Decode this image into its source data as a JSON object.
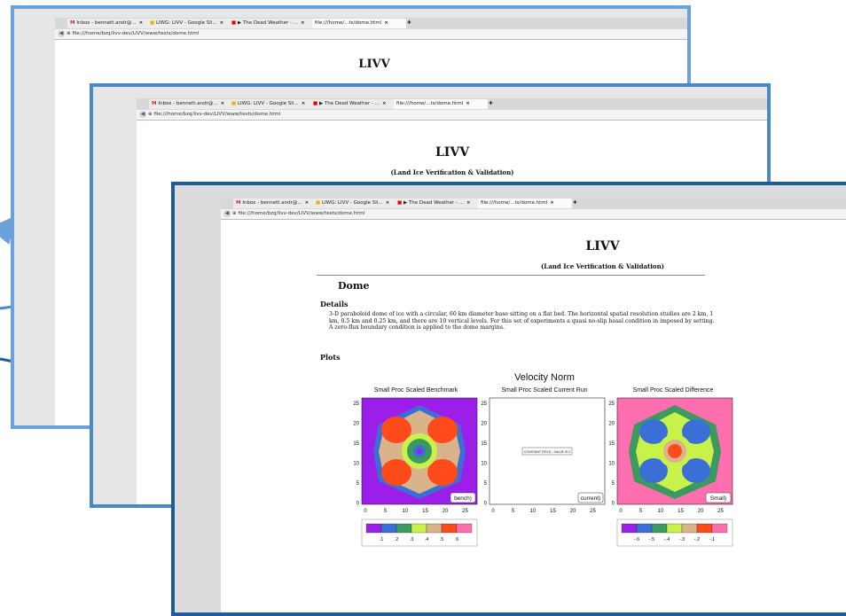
{
  "browser": {
    "tabs": [
      {
        "label": "Inbox - bennett.andr@...",
        "icon": "gmail-icon"
      },
      {
        "label": "LIWG: LIVV - Google Sli...",
        "icon": "slides-icon"
      },
      {
        "label": "▶ The Dead Weather - ...",
        "icon": "youtube-icon"
      },
      {
        "label": "file:///home/...ts/dome.html",
        "icon": ""
      }
    ],
    "url": "file:///home/bzq/livv-dev/LIVV/www/tests/dome.html"
  },
  "page": {
    "title": "LIVV",
    "subtitle": "(Land Ice Verification & Validation)",
    "section_title": "Dome",
    "details_heading": "Details",
    "details_text": "3-D paraboloid dome of ice with a circular, 60 km diameter base sitting on a flat bed. The horizontal spatial resolution studies are 2 km, 1 km, 0.5 km and 0.25 km, and there are 10 vertical levels. For this set of experiments a quasi no-slip basal condition in imposed by setting. A zero-flux boundary condition is applied to the dome margins.",
    "plots_heading": "Plots"
  },
  "figure": {
    "title": "Velocity Norm",
    "panels": [
      {
        "title": "Small Proc Scaled Benchmark",
        "label": "bench)"
      },
      {
        "title": "Small Proc Scaled Current Run",
        "label": "current)",
        "note": "CONSTANT FIELD - VALUE IS 0"
      },
      {
        "title": "Small Proc Scaled Difference",
        "label": "Small)"
      }
    ],
    "x_ticks": [
      "0",
      "5",
      "10",
      "15",
      "20",
      "25"
    ],
    "y_ticks": [
      "25",
      "20",
      "15",
      "10",
      "5",
      "0"
    ],
    "legend_bench": [
      ".1",
      ".2",
      ".3",
      ".4",
      ".5",
      ".6"
    ],
    "legend_diff": [
      "-.6",
      "-.5",
      "-.4",
      "-.3",
      "-.2",
      "-.1"
    ],
    "bench_colors": [
      "#9b1fe8",
      "#3b6fd6",
      "#3c9a5f",
      "#c8f24a",
      "#d9b48a",
      "#ff4a1a",
      "#ff6fb0"
    ],
    "diff_colors": [
      "#9b1fe8",
      "#3b6fd6",
      "#3c9a5f",
      "#c8f24a",
      "#d9b48a",
      "#ff4a1a",
      "#ff6fb0"
    ]
  }
}
